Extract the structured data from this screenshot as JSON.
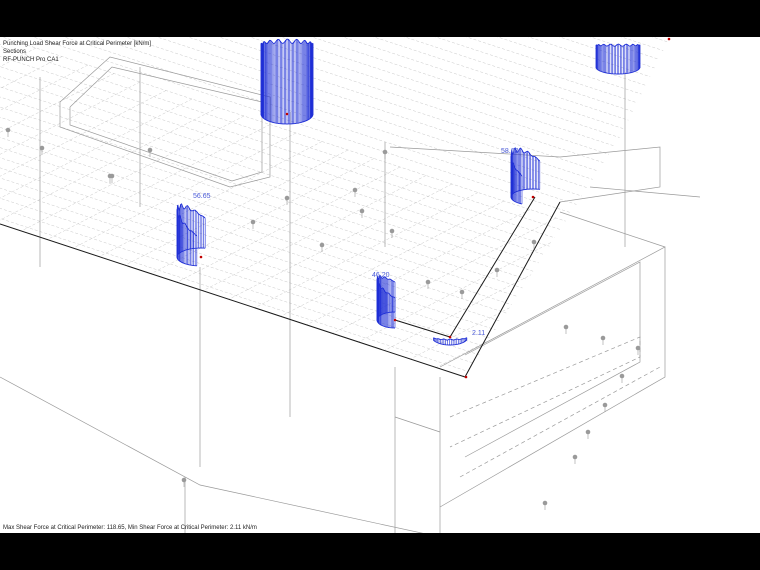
{
  "header": {
    "title": "Punching Load Shear Force at Critical Perimeter [kN/m]",
    "sections": "Sections",
    "module": "RF-PUNCH Pro CA1"
  },
  "labels": {
    "top_right": "58.62",
    "center_left": "56.65",
    "center": "46.20",
    "corner": "2.11"
  },
  "footer": {
    "summary": "Max Shear Force at Critical Perimeter: 118.65, Min Shear Force at Critical Perimeter: 2.11 kN/m"
  },
  "colors": {
    "diagram": "#1f2fd6",
    "structure": "#8a8a8a",
    "mesh": "#c8c8c8",
    "node": "#c00000",
    "background": "#ffffff",
    "letterbox": "#000000"
  }
}
